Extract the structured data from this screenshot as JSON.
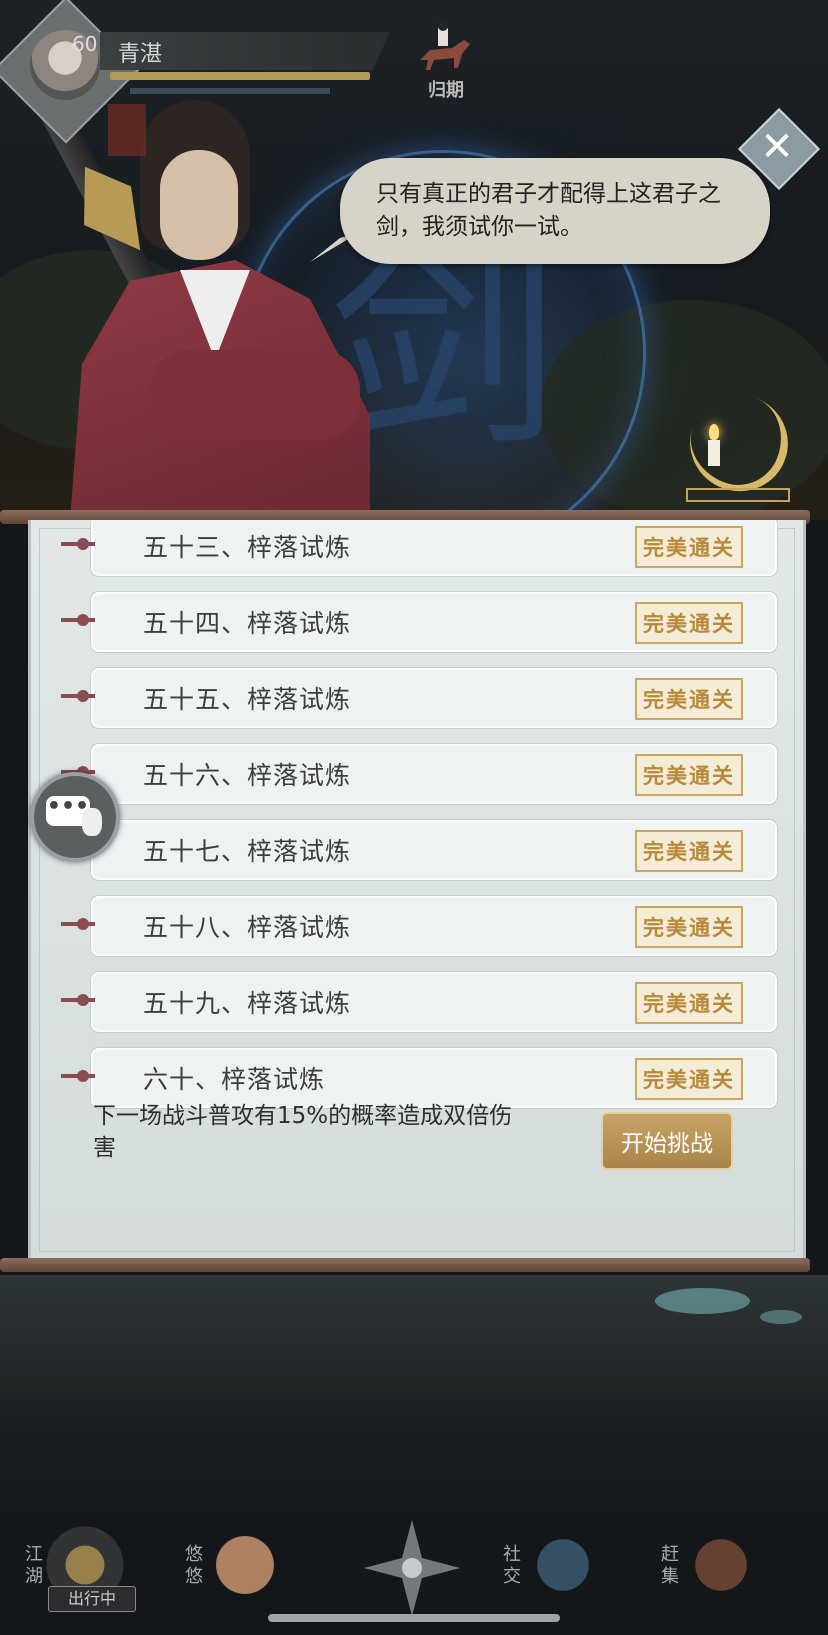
{
  "player": {
    "level": "60",
    "name": "青湛"
  },
  "header": {
    "return_label": "归期"
  },
  "dialog": {
    "text": "只有真正的君子才配得上这君子之剑，我须试你一试。"
  },
  "scene": {
    "emblem_char": "剑"
  },
  "trials": [
    {
      "label": "五十三、梓落试炼",
      "status": "完美通关"
    },
    {
      "label": "五十四、梓落试炼",
      "status": "完美通关"
    },
    {
      "label": "五十五、梓落试炼",
      "status": "完美通关"
    },
    {
      "label": "五十六、梓落试炼",
      "status": "完美通关"
    },
    {
      "label": "五十七、梓落试炼",
      "status": "完美通关"
    },
    {
      "label": "五十八、梓落试炼",
      "status": "完美通关"
    },
    {
      "label": "五十九、梓落试炼",
      "status": "完美通关"
    },
    {
      "label": "六十、梓落试炼",
      "status": "完美通关"
    }
  ],
  "footer": {
    "buff_text": "下一场战斗普攻有15%的概率造成双倍伤害",
    "start_button": "开始挑战"
  },
  "chat": {
    "dots": "•••"
  },
  "nav": {
    "items": [
      {
        "label": "江湖",
        "badge": "出行中"
      },
      {
        "label": "悠悠"
      },
      {
        "label": "社交"
      },
      {
        "label": "赶集"
      }
    ]
  },
  "colors": {
    "accent_gold": "#c9a465",
    "robe_red": "#8f3a44",
    "panel_bg": "#e2e7e7"
  }
}
